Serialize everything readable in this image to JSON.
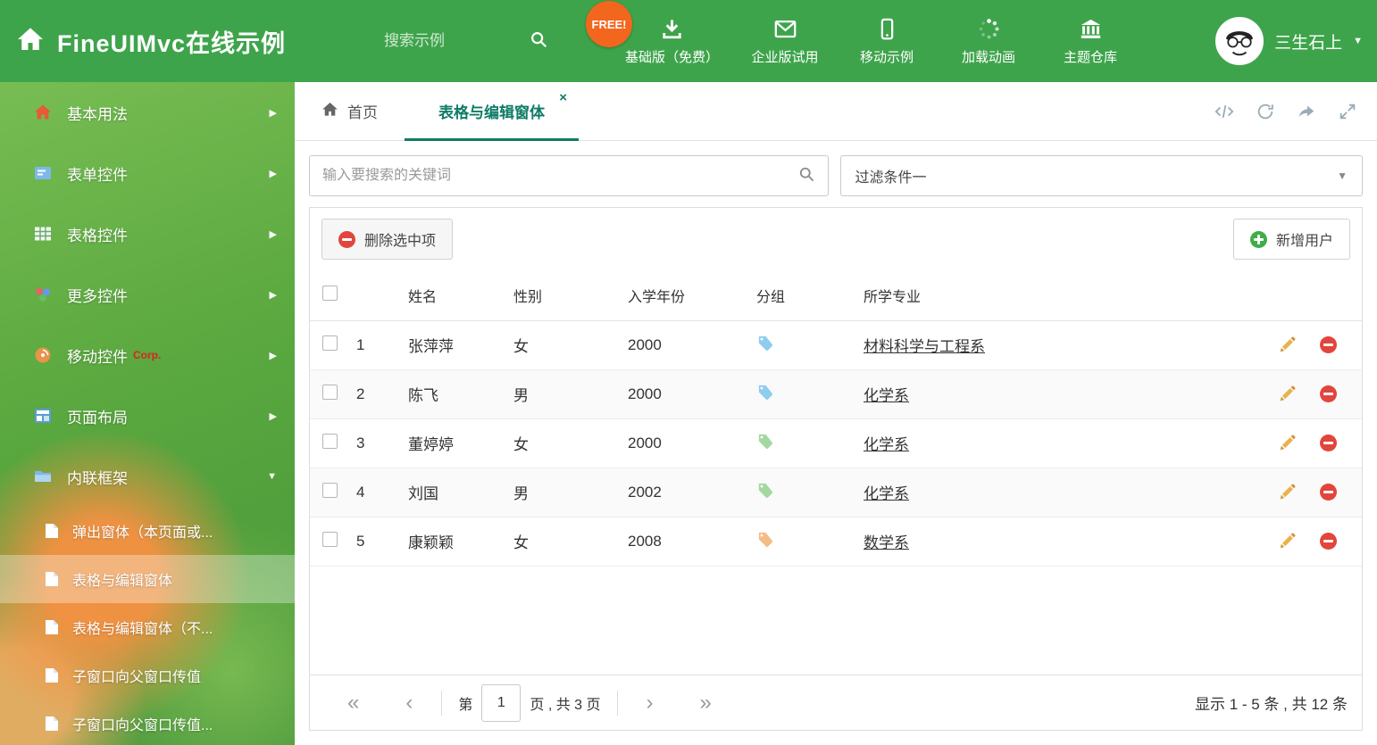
{
  "header": {
    "title": "FineUIMvc在线示例",
    "search_placeholder": "搜索示例",
    "free_badge": "FREE!",
    "nav_items": [
      {
        "label": "基础版（免费）",
        "icon": "download-icon"
      },
      {
        "label": "企业版试用",
        "icon": "envelope-icon"
      },
      {
        "label": "移动示例",
        "icon": "mobile-icon"
      },
      {
        "label": "加载动画",
        "icon": "spinner-icon"
      },
      {
        "label": "主题仓库",
        "icon": "bank-icon"
      }
    ],
    "username": "三生石上"
  },
  "sidebar": {
    "items": [
      {
        "label": "基本用法",
        "icon": "home-icon",
        "state": "collapsed"
      },
      {
        "label": "表单控件",
        "icon": "form-icon",
        "state": "collapsed"
      },
      {
        "label": "表格控件",
        "icon": "grid-icon",
        "state": "collapsed"
      },
      {
        "label": "更多控件",
        "icon": "widgets-icon",
        "state": "collapsed"
      },
      {
        "label": "移动控件",
        "icon": "signal-icon",
        "badge": "Corp.",
        "state": "collapsed"
      },
      {
        "label": "页面布局",
        "icon": "layout-icon",
        "state": "collapsed"
      },
      {
        "label": "内联框架",
        "icon": "folder-icon",
        "state": "expanded"
      }
    ],
    "children": [
      {
        "label": "弹出窗体（本页面或...",
        "selected": false
      },
      {
        "label": "表格与编辑窗体",
        "selected": true
      },
      {
        "label": "表格与编辑窗体（不...",
        "selected": false
      },
      {
        "label": "子窗口向父窗口传值",
        "selected": false
      },
      {
        "label": "子窗口向父窗口传值...",
        "selected": false
      }
    ]
  },
  "tabs": {
    "home_label": "首页",
    "active_label": "表格与编辑窗体",
    "close_glyph": "×"
  },
  "filters": {
    "search_placeholder": "输入要搜索的关键词",
    "filter_value": "过滤条件一"
  },
  "toolbar": {
    "delete_label": "删除选中项",
    "add_label": "新增用户"
  },
  "table": {
    "columns": [
      "姓名",
      "性别",
      "入学年份",
      "分组",
      "所学专业"
    ],
    "rows": [
      {
        "index": "1",
        "name": "张萍萍",
        "gender": "女",
        "year": "2000",
        "tag_color": "#8ecdec",
        "major": "材料科学与工程系"
      },
      {
        "index": "2",
        "name": "陈飞",
        "gender": "男",
        "year": "2000",
        "tag_color": "#8ecdec",
        "major": "化学系"
      },
      {
        "index": "3",
        "name": "董婷婷",
        "gender": "女",
        "year": "2000",
        "tag_color": "#a3d8a0",
        "major": "化学系"
      },
      {
        "index": "4",
        "name": "刘国",
        "gender": "男",
        "year": "2002",
        "tag_color": "#a3d8a0",
        "major": "化学系"
      },
      {
        "index": "5",
        "name": "康颖颖",
        "gender": "女",
        "year": "2008",
        "tag_color": "#f4bd85",
        "major": "数学系"
      }
    ]
  },
  "pagination": {
    "first_glyph": "«",
    "prev_glyph": "‹",
    "page_prefix": "第",
    "page_value": "1",
    "page_suffix": "页 , 共 3 页",
    "next_glyph": "›",
    "last_glyph": "»",
    "summary": "显示 1 - 5 条 , 共 12 条"
  },
  "colors": {
    "header_green": "#3ea44b",
    "accent_teal": "#0e7b66",
    "danger_red": "#e2453c",
    "success_green": "#3fae49",
    "free_orange": "#f2661e"
  }
}
